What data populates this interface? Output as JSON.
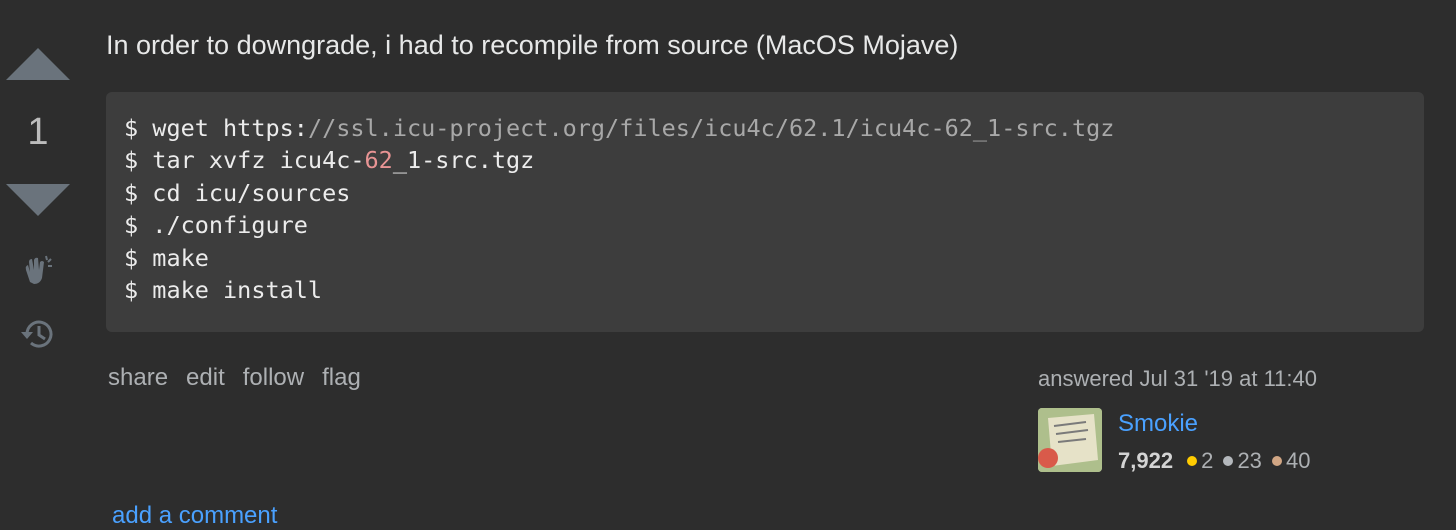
{
  "vote": {
    "count": "1"
  },
  "post": {
    "text": "In order to downgrade, i had to recompile from source (MacOS Mojave)",
    "code": {
      "line1_prefix": "$ wget https:",
      "line1_url": "//ssl.icu-project.org/files/icu4c/62.1/icu4c-62_1-src.tgz",
      "line2_prefix": "$ tar xvfz icu4c-",
      "line2_num": "62",
      "line2_suffix": "_1-src.tgz",
      "line3": "$ cd icu/sources",
      "line4": "$ ./configure",
      "line5": "$ make",
      "line6": "$ make install"
    }
  },
  "menu": {
    "share": "share",
    "edit": "edit",
    "follow": "follow",
    "flag": "flag"
  },
  "user": {
    "action_time": "answered Jul 31 '19 at 11:40",
    "name": "Smokie",
    "reputation": "7,922",
    "gold": "2",
    "silver": "23",
    "bronze": "40"
  },
  "comments": {
    "add_label": "add a comment"
  },
  "colors": {
    "accent_link": "#4aa1ff",
    "gold": "#ffcc01",
    "silver": "#b4b8bc",
    "bronze": "#d1a684"
  },
  "icons": [
    "upvote-arrow-icon",
    "downvote-arrow-icon",
    "clap-icon",
    "history-icon"
  ]
}
